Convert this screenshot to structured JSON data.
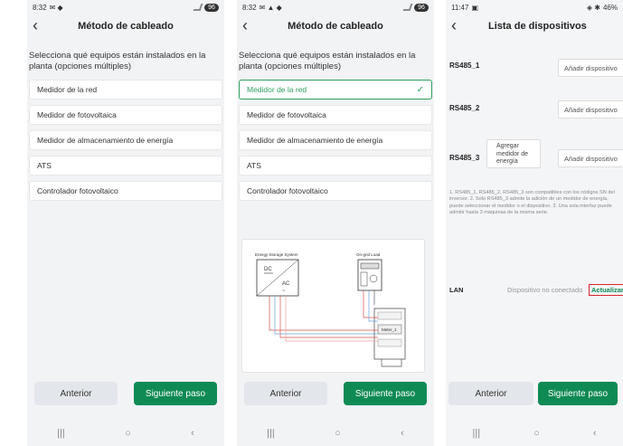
{
  "screen1": {
    "status": {
      "time": "8:32",
      "battery": "96"
    },
    "title": "Método de cableado",
    "description": "Selecciona qué equipos están instalados en la planta (opciones múltiples)",
    "options": [
      "Medidor de la red",
      "Medidor de fotovoltaica",
      "Medidor de almacenamiento de energía",
      "ATS",
      "Controlador fotovoltaico"
    ],
    "prev_label": "Anterior",
    "next_label": "Siguiente paso"
  },
  "screen2": {
    "status": {
      "time": "8:32",
      "battery": "96"
    },
    "title": "Método de cableado",
    "description": "Selecciona qué equipos están instalados en la planta (opciones múltiples)",
    "selected_option": "Medidor de la red",
    "options": [
      "Medidor de fotovoltaica",
      "Medidor de almacenamiento de energía",
      "ATS",
      "Controlador fotovoltaico"
    ],
    "diagram": {
      "ess_label": "Energy Storage System",
      "load_label": "On-grid Load",
      "dc_label": "DC",
      "ac_label": "AC",
      "meter_label": "Meter_1"
    },
    "prev_label": "Anterior",
    "next_label": "Siguiente paso"
  },
  "screen3": {
    "status": {
      "time": "11:47",
      "battery": "46%"
    },
    "title": "Lista de dispositivos",
    "rows": [
      {
        "label": "RS485_1",
        "button": "Añadir dispositivo"
      },
      {
        "label": "RS485_2",
        "button": "Añadir dispositivo"
      },
      {
        "label": "RS485_3",
        "button": "Añadir dispositivo"
      }
    ],
    "meter_button": "Agregar medidor de energía",
    "notes": "1. RS485_1, RS485_2, RS485_3 son compatibles con los códigos SN del inversor. 2. Solo RS485_3 admite la adición de un medidor de energía, puede seleccionar el medidor o el dispositivo. 3. Una sola interfaz puede admitir hasta 3 máquinas de la misma serie.",
    "lan_label": "LAN",
    "lan_status": "Dispositivo no conectado",
    "update_label": "Actualizar",
    "prev_label": "Anterior",
    "next_label": "Siguiente paso"
  },
  "colors": {
    "primary": "#0f8a55",
    "selected": "#2e9e5e",
    "highlight": "#d9262b"
  }
}
